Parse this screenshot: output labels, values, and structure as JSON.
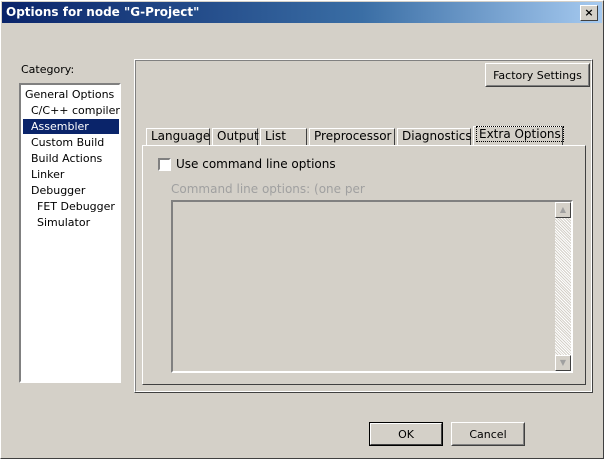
{
  "window": {
    "title": "Options for node \"G-Project\"",
    "close_glyph": "×"
  },
  "category": {
    "label": "Category:",
    "items": [
      {
        "label": "General Options"
      },
      {
        "label": "C/C++ compiler"
      },
      {
        "label": "Assembler",
        "selected": true
      },
      {
        "label": "Custom Build"
      },
      {
        "label": "Build Actions"
      },
      {
        "label": "Linker"
      },
      {
        "label": "Debugger"
      },
      {
        "label": "FET Debugger"
      },
      {
        "label": "Simulator"
      }
    ]
  },
  "factory_settings_label": "Factory Settings",
  "tabs": [
    {
      "label": "Language"
    },
    {
      "label": "Output"
    },
    {
      "label": "List"
    },
    {
      "label": "Preprocessor"
    },
    {
      "label": "Diagnostics"
    },
    {
      "label": "Extra Options",
      "active": true
    }
  ],
  "extra_options": {
    "use_cmdline_label": "Use command line options",
    "use_cmdline_checked": false,
    "cmdline_label": "Command line options:  (one per",
    "cmdline_value": ""
  },
  "buttons": {
    "ok": "OK",
    "cancel": "Cancel"
  },
  "icons": {
    "scroll_up": "▲",
    "scroll_down": "▼"
  }
}
